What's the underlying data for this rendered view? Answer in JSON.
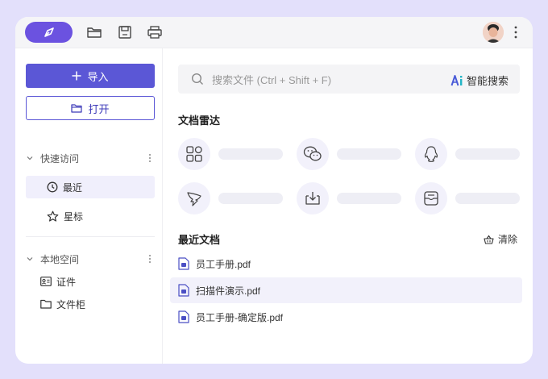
{
  "toolbar": {
    "icons": [
      "pen-logo-icon",
      "folder-icon",
      "save-icon",
      "print-icon",
      "more-vertical-icon"
    ],
    "accent": "#6b52e0"
  },
  "sidebar": {
    "import_label": "导入",
    "open_label": "打开",
    "quick_access": {
      "title": "快速访问",
      "items": [
        {
          "label": "最近",
          "icon": "clock-icon",
          "active": true
        },
        {
          "label": "星标",
          "icon": "star-icon",
          "active": false
        }
      ]
    },
    "local_space": {
      "title": "本地空间",
      "items": [
        {
          "label": "证件",
          "icon": "id-card-icon"
        },
        {
          "label": "文件柜",
          "icon": "folder-icon"
        }
      ]
    }
  },
  "search": {
    "placeholder": "搜索文件 (Ctrl + Shift + F)",
    "smart_label": "智能搜索"
  },
  "radar": {
    "title": "文档雷达",
    "sources": [
      "apps-grid-icon",
      "wechat-icon",
      "qq-icon",
      "dingtalk-icon",
      "download-icon",
      "mail-inbox-icon"
    ]
  },
  "recent": {
    "title": "最近文档",
    "clear_label": "清除",
    "files": [
      {
        "name": "员工手册.pdf",
        "active": false
      },
      {
        "name": "扫描件演示.pdf",
        "active": true
      },
      {
        "name": "员工手册-确定版.pdf",
        "active": false
      }
    ]
  },
  "colors": {
    "primary": "#5b57d6",
    "background": "#e3e0fb",
    "active_bg": "#f0effc"
  }
}
